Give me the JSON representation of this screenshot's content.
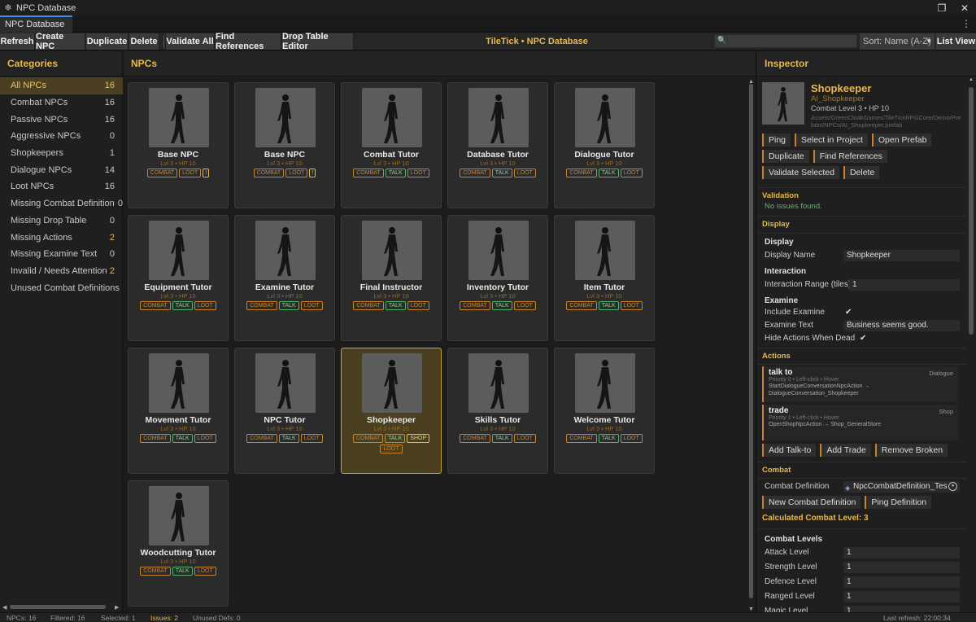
{
  "window": {
    "title": "NPC Database",
    "tab": "NPC Database"
  },
  "toolbar": {
    "buttons": [
      "Refresh",
      "Create NPC",
      "Duplicate",
      "Delete",
      "Validate All",
      "Find References",
      "Drop Table Editor"
    ],
    "title": "TileTick • NPC Database",
    "search_placeholder": "",
    "sort": "Sort: Name (A-Z)",
    "list_view": "List View"
  },
  "categories": {
    "header": "Categories",
    "items": [
      {
        "label": "All NPCs",
        "count": "16"
      },
      {
        "label": "Combat NPCs",
        "count": "16"
      },
      {
        "label": "Passive NPCs",
        "count": "16"
      },
      {
        "label": "Aggressive NPCs",
        "count": "0"
      },
      {
        "label": "Shopkeepers",
        "count": "1"
      },
      {
        "label": "Dialogue NPCs",
        "count": "14"
      },
      {
        "label": "Loot NPCs",
        "count": "16"
      },
      {
        "label": "Missing Combat Definition",
        "count": "0"
      },
      {
        "label": "Missing Drop Table",
        "count": "0"
      },
      {
        "label": "Missing Actions",
        "count": "2"
      },
      {
        "label": "Missing Examine Text",
        "count": "0"
      },
      {
        "label": "Invalid / Needs Attention",
        "count": "2"
      },
      {
        "label": "Unused Combat Definitions",
        "count": ""
      }
    ]
  },
  "npcs": {
    "header": "NPCs",
    "stats": "Lvl 3 • HP 10",
    "cards": [
      {
        "name": "Base NPC",
        "tags": [
          "COMBAT",
          "LOOT",
          "!"
        ]
      },
      {
        "name": "Base NPC",
        "tags": [
          "COMBAT",
          "LOOT",
          "!"
        ]
      },
      {
        "name": "Combat Tutor",
        "tags": [
          "COMBAT",
          "TALK",
          "LOOT"
        ]
      },
      {
        "name": "Database Tutor",
        "tags": [
          "COMBAT",
          "TALK",
          "LOOT"
        ]
      },
      {
        "name": "Dialogue Tutor",
        "tags": [
          "COMBAT",
          "TALK",
          "LOOT"
        ]
      },
      {
        "name": "Equipment Tutor",
        "tags": [
          "COMBAT",
          "TALK",
          "LOOT"
        ]
      },
      {
        "name": "Examine Tutor",
        "tags": [
          "COMBAT",
          "TALK",
          "LOOT"
        ]
      },
      {
        "name": "Final Instructor",
        "tags": [
          "COMBAT",
          "TALK",
          "LOOT"
        ]
      },
      {
        "name": "Inventory Tutor",
        "tags": [
          "COMBAT",
          "TALK",
          "LOOT"
        ]
      },
      {
        "name": "Item Tutor",
        "tags": [
          "COMBAT",
          "TALK",
          "LOOT"
        ]
      },
      {
        "name": "Movement Tutor",
        "tags": [
          "COMBAT",
          "TALK",
          "LOOT"
        ]
      },
      {
        "name": "NPC Tutor",
        "tags": [
          "COMBAT",
          "TALK",
          "LOOT"
        ]
      },
      {
        "name": "Shopkeeper",
        "tags": [
          "COMBAT",
          "TALK",
          "SHOP",
          "LOOT"
        ],
        "selected": true
      },
      {
        "name": "Skills Tutor",
        "tags": [
          "COMBAT",
          "TALK",
          "LOOT"
        ]
      },
      {
        "name": "Welcome Tutor",
        "tags": [
          "COMBAT",
          "TALK",
          "LOOT"
        ]
      },
      {
        "name": "Woodcutting Tutor",
        "tags": [
          "COMBAT",
          "TALK",
          "LOOT"
        ]
      }
    ]
  },
  "inspector": {
    "header": "Inspector",
    "name": "Shopkeeper",
    "asset": "AI_Shopkeeper",
    "level_line": "Combat Level 3   •   HP 10",
    "path": "Assets/GreenCloakGames/TileTickRPGCore/Demo/Prefabs/NPCs/AI_Shopkeeper.prefab",
    "buttons_row1": [
      "Ping",
      "Select in Project",
      "Open Prefab"
    ],
    "buttons_row2": [
      "Duplicate",
      "Find References"
    ],
    "buttons_row3": [
      "Validate Selected",
      "Delete"
    ],
    "validation": {
      "title": "Validation",
      "message": "No issues found."
    },
    "display": {
      "title": "Display",
      "sub": "Display",
      "name_label": "Display Name",
      "name_value": "Shopkeeper",
      "interaction_sub": "Interaction",
      "range_label": "Interaction Range (tiles)",
      "range_value": "1",
      "examine_sub": "Examine",
      "include_label": "Include Examine",
      "examine_label": "Examine Text",
      "examine_value": "Business seems good.",
      "hide_label": "Hide Actions When Dead",
      "check": "✔"
    },
    "actions": {
      "title": "Actions",
      "items": [
        {
          "name": "talk to",
          "type": "Dialogue",
          "meta": "Priority 0   •   Left-click   •   Hover",
          "desc": "StartDialogueConversationNpcAction → DialogueConversation_Shopkeeper"
        },
        {
          "name": "trade",
          "type": "Shop",
          "meta": "Priority 1   •   Left-click   •   Hover",
          "desc": "OpenShopNpcAction → Shop_GeneralStore"
        }
      ],
      "buttons": [
        "Add Talk-to",
        "Add Trade",
        "Remove Broken"
      ]
    },
    "combat": {
      "title": "Combat",
      "def_label": "Combat Definition",
      "def_value": "NpcCombatDefinition_Tes",
      "buttons": [
        "New Combat Definition",
        "Ping Definition"
      ],
      "calc": "Calculated Combat Level: 3",
      "levels_sub": "Combat Levels",
      "levels": [
        {
          "label": "Attack Level",
          "value": "1"
        },
        {
          "label": "Strength Level",
          "value": "1"
        },
        {
          "label": "Defence Level",
          "value": "1"
        },
        {
          "label": "Ranged Level",
          "value": "1"
        },
        {
          "label": "Magic Level",
          "value": "1"
        }
      ]
    }
  },
  "status": {
    "npcs": "NPCs: 16",
    "filtered": "Filtered: 16",
    "selected": "Selected: 1",
    "issues": "Issues: 2",
    "unused": "Unused Defs: 0",
    "refresh": "Last refresh: 22:00:34"
  },
  "colors": {
    "accent": "#e8b84a",
    "selected_bg": "#4a3f22",
    "talk": "#55b26c",
    "combat": "#c9842b"
  }
}
